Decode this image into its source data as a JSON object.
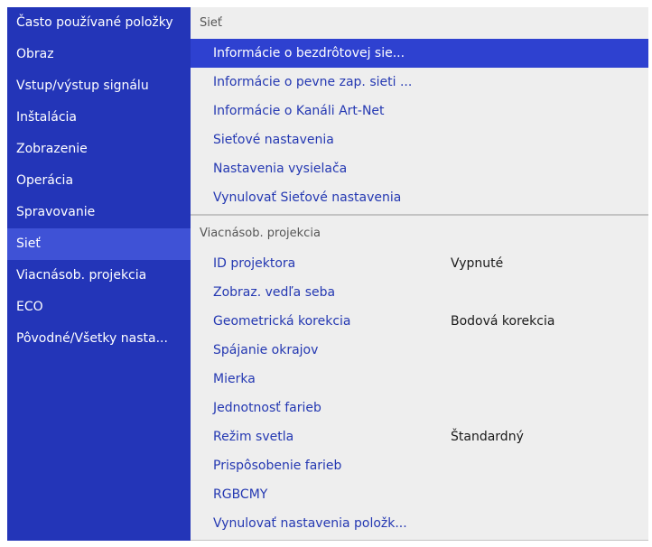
{
  "sidebar": {
    "items": [
      {
        "label": "Často používané položky"
      },
      {
        "label": "Obraz"
      },
      {
        "label": "Vstup/výstup signálu"
      },
      {
        "label": "Inštalácia"
      },
      {
        "label": "Zobrazenie"
      },
      {
        "label": "Operácia"
      },
      {
        "label": "Spravovanie"
      },
      {
        "label": "Sieť"
      },
      {
        "label": "Viacnásob. projekcia"
      },
      {
        "label": "ECO"
      },
      {
        "label": "Pôvodné/Všetky nasta..."
      }
    ],
    "active": "Sieť"
  },
  "panel": {
    "section1": {
      "title": "Sieť",
      "items": [
        {
          "label": "Informácie o bezdrôtovej sie..."
        },
        {
          "label": "Informácie o pevne zap. sieti ..."
        },
        {
          "label": "Informácie o Kanáli Art-Net"
        },
        {
          "label": "Sieťové nastavenia"
        },
        {
          "label": "Nastavenia vysielača"
        },
        {
          "label": "Vynulovať Sieťové nastavenia"
        }
      ]
    },
    "section2": {
      "title": "Viacnásob. projekcia",
      "items": [
        {
          "label": "ID projektora",
          "value": "Vypnuté"
        },
        {
          "label": "Zobraz. vedľa seba",
          "value": ""
        },
        {
          "label": "Geometrická korekcia",
          "value": "Bodová korekcia"
        },
        {
          "label": "Spájanie okrajov",
          "value": ""
        },
        {
          "label": "Mierka",
          "value": ""
        },
        {
          "label": "Jednotnosť farieb",
          "value": ""
        },
        {
          "label": "Režim svetla",
          "value": "Štandardný"
        },
        {
          "label": "Prispôsobenie farieb",
          "value": ""
        },
        {
          "label": "RGBCMY",
          "value": ""
        },
        {
          "label": "Vynulovať nastavenia položk...",
          "value": ""
        }
      ]
    }
  },
  "colors": {
    "sidebar_bg": "#2335b8",
    "sidebar_active": "#3f52d6",
    "panel_bg": "#eeeeee",
    "selection": "#2e41d0",
    "item_text": "#2438b2"
  }
}
